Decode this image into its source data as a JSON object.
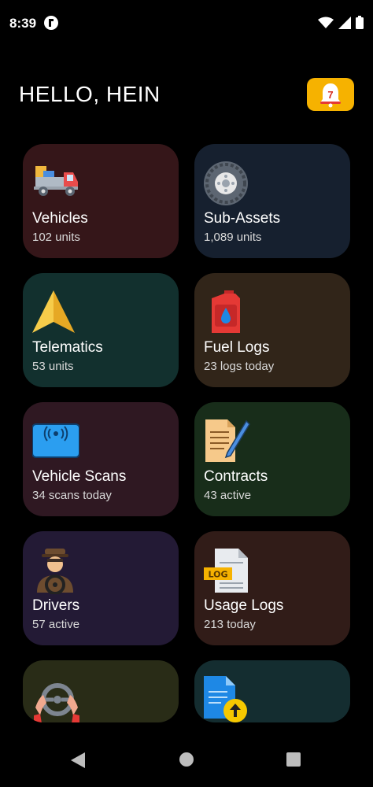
{
  "status": {
    "time": "8:39"
  },
  "header": {
    "greeting": "HELLO, HEIN",
    "notifications_count": "7"
  },
  "cards": [
    {
      "id": "vehicles",
      "title": "Vehicles",
      "sub": "102 units",
      "bg": "#351619",
      "icon": "truck-icon"
    },
    {
      "id": "sub-assets",
      "title": "Sub-Assets",
      "sub": "1,089 units",
      "bg": "#16202f",
      "icon": "tire-icon"
    },
    {
      "id": "telematics",
      "title": "Telematics",
      "sub": "53 units",
      "bg": "#12302e",
      "icon": "navigation-arrow-icon"
    },
    {
      "id": "fuel-logs",
      "title": "Fuel Logs",
      "sub": "23 logs today",
      "bg": "#312519",
      "icon": "fuel-can-icon"
    },
    {
      "id": "vehicle-scans",
      "title": "Vehicle Scans",
      "sub": "34 scans today",
      "bg": "#2f1822",
      "icon": "rfid-icon"
    },
    {
      "id": "contracts",
      "title": "Contracts",
      "sub": "43 active",
      "bg": "#182d1a",
      "icon": "contract-icon"
    },
    {
      "id": "drivers",
      "title": "Drivers",
      "sub": "57 active",
      "bg": "#231a35",
      "icon": "driver-icon"
    },
    {
      "id": "usage-logs",
      "title": "Usage Logs",
      "sub": "213 today",
      "bg": "#311c18",
      "icon": "log-file-icon"
    },
    {
      "id": "steering",
      "title": "",
      "sub": "",
      "bg": "#292c17",
      "icon": "steering-wheel-icon"
    },
    {
      "id": "upload",
      "title": "",
      "sub": "",
      "bg": "#142d30",
      "icon": "document-upload-icon"
    }
  ],
  "nav": {
    "back": "back-icon",
    "home": "home-icon",
    "recents": "recents-icon"
  }
}
